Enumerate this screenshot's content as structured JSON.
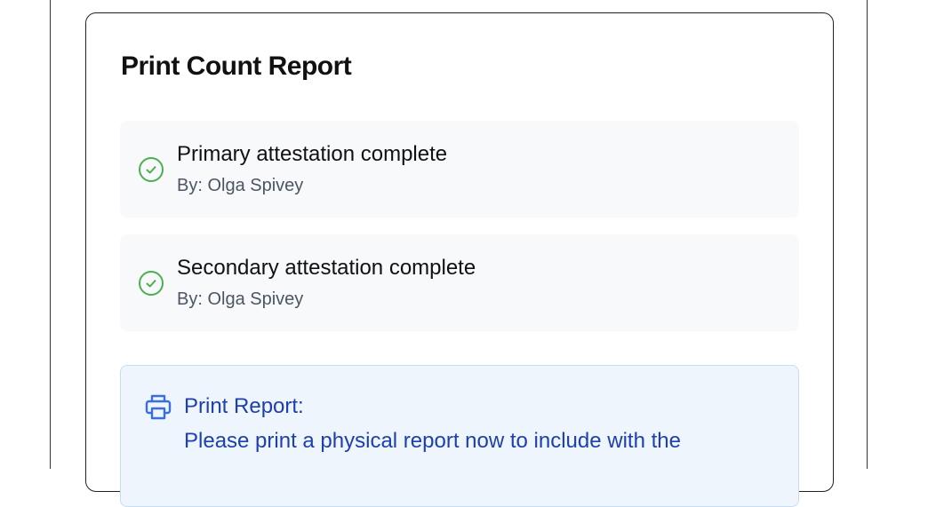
{
  "report": {
    "title": "Print Count Report",
    "steps": [
      {
        "title": "Primary attestation complete",
        "by": "By: Olga Spivey",
        "status_icon": "check-circle-icon"
      },
      {
        "title": "Secondary attestation complete",
        "by": "By: Olga Spivey",
        "status_icon": "check-circle-icon"
      }
    ],
    "notice": {
      "icon": "printer-icon",
      "title": "Print Report:",
      "body": "Please print a physical report now to include with the"
    }
  },
  "colors": {
    "success": "#4caf50",
    "notice_text": "#1e40af",
    "notice_bg": "#eef5fd",
    "notice_border": "#c7dcf3",
    "step_bg": "#f8f9fb"
  }
}
